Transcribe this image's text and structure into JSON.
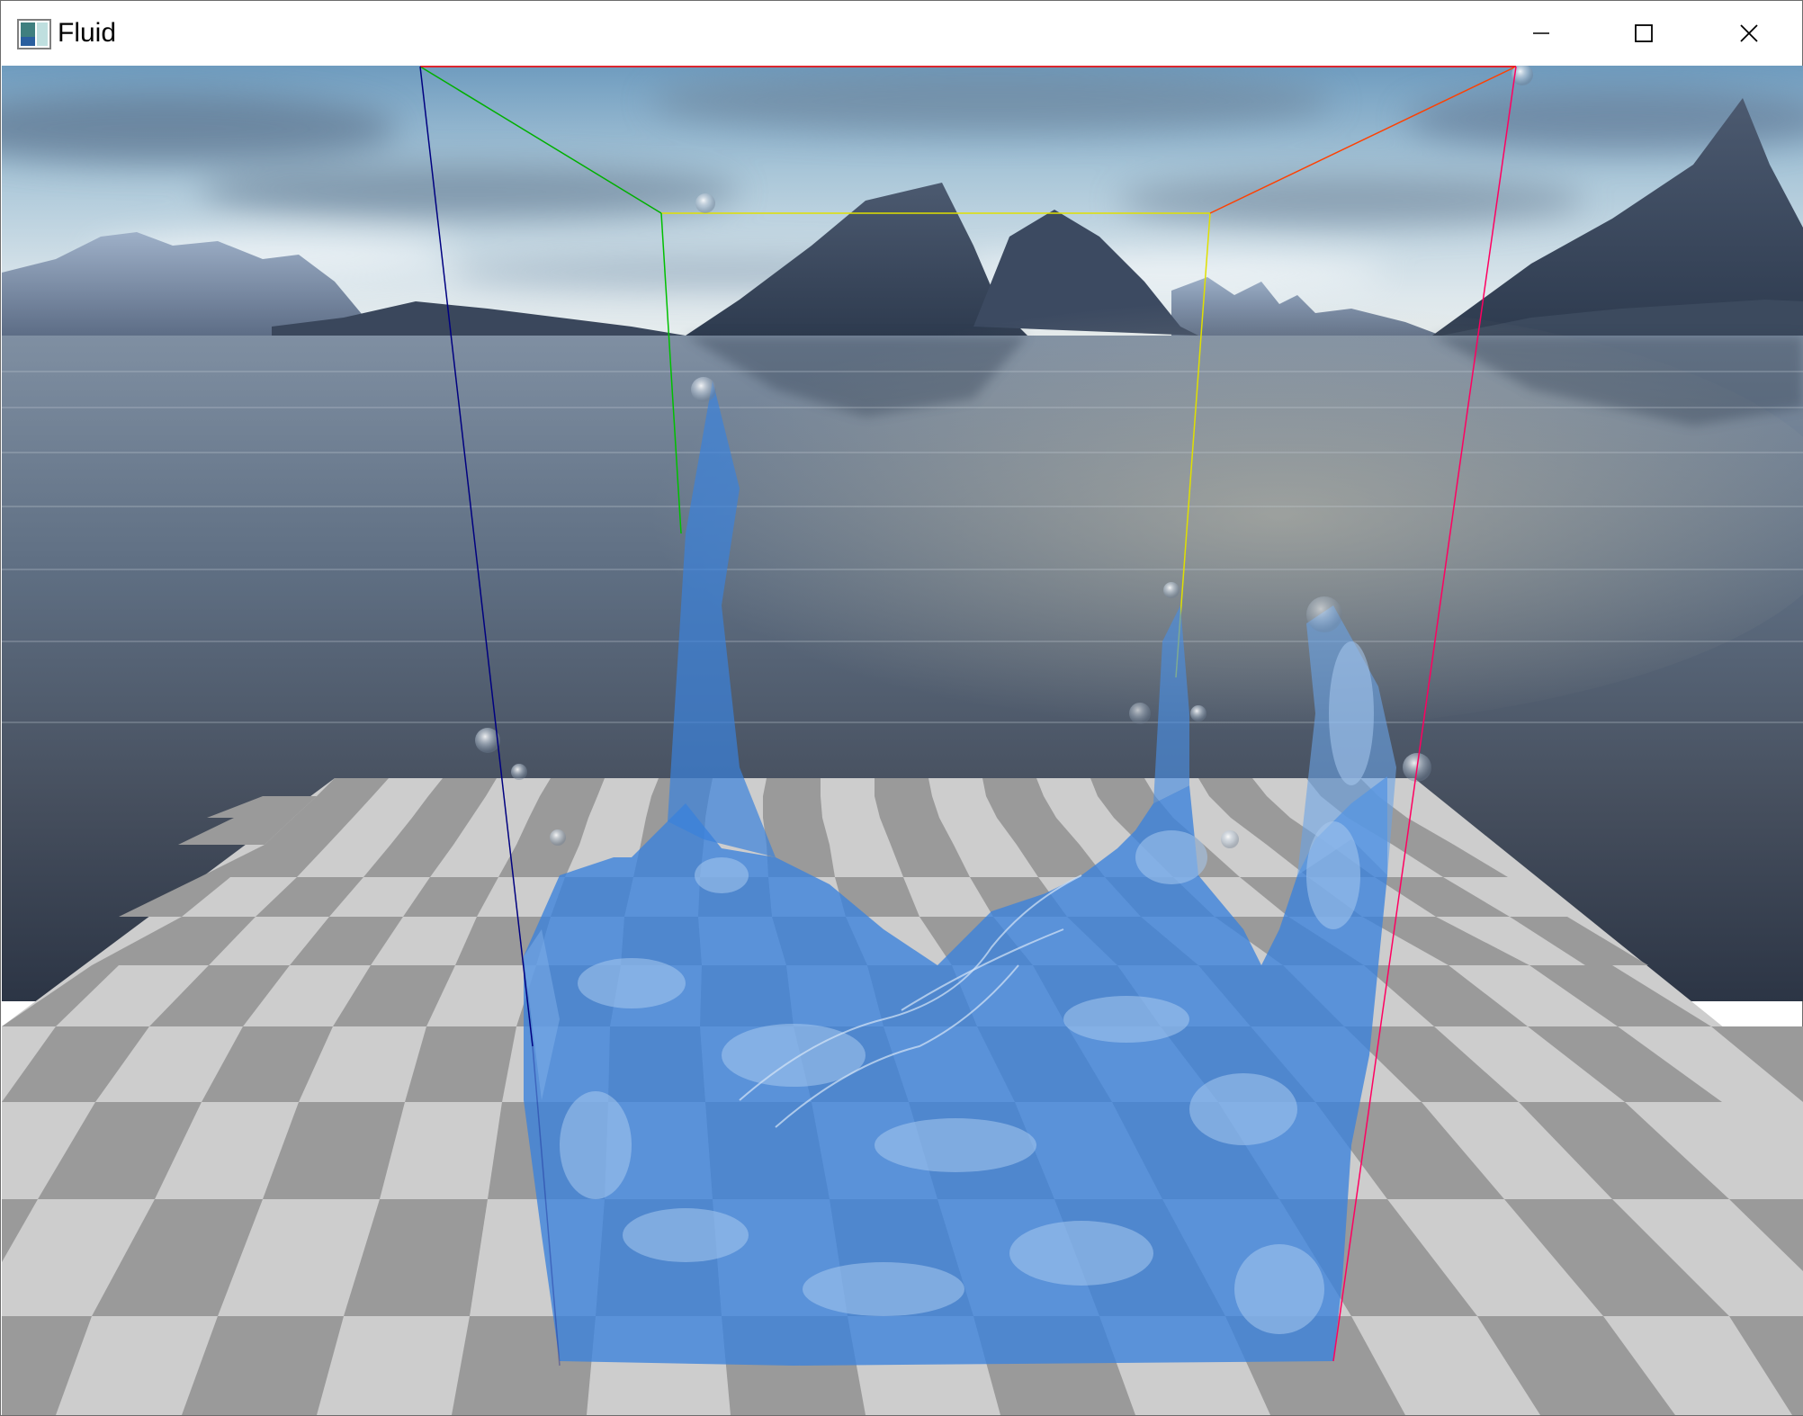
{
  "window": {
    "title": "Fluid",
    "app_icon": "app-window-icon",
    "controls": [
      {
        "name": "minimize",
        "icon": "minimize-icon"
      },
      {
        "name": "maximize",
        "icon": "maximize-icon"
      },
      {
        "name": "close",
        "icon": "close-icon"
      }
    ]
  },
  "scene": {
    "background": "mountain-lake-skybox",
    "floor": "checkerboard-plane",
    "colors": {
      "sky_top": "#7da9c9",
      "sky_horizon": "#e8eef0",
      "water_far": "#6c7f95",
      "water_near": "#2e3a4e",
      "checker_light": "#cccccc",
      "checker_dark": "#999999",
      "fluid": "#3a82dc",
      "box_x_axis": "#ff0000",
      "box_y_axis": "#00c000",
      "box_z_axis": "#000080"
    }
  }
}
